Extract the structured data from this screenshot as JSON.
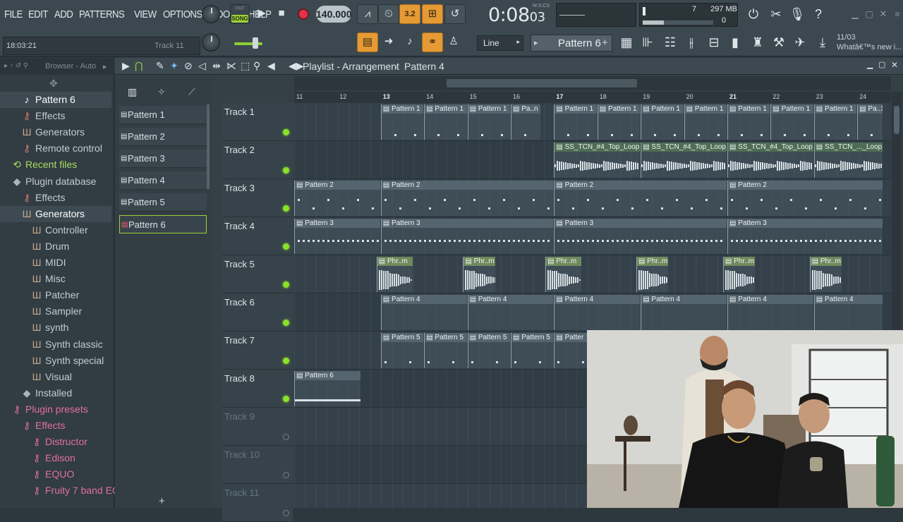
{
  "menu": [
    "FILE",
    "EDIT",
    "ADD",
    "PATTERNS",
    "VIEW",
    "OPTIONS",
    "TOOLS",
    "HELP"
  ],
  "transport": {
    "song_mode": "SONG",
    "pat_mode": "PAT",
    "tempo": "140.000",
    "time_label": "M:S:CS",
    "time_main": "0:08",
    "time_cs": "03",
    "step_value": "3.2"
  },
  "hint_bar": {
    "clock": "18:03:21",
    "track": "Track 11"
  },
  "cpu": {
    "value": "7",
    "memory": "297 MB",
    "polyphony": "0"
  },
  "toolbar2": {
    "snap_label": "Line",
    "pattern_selector": "Pattern 6",
    "news_date": "11/03",
    "news_text": "Whatâ€™s new i..."
  },
  "browser": {
    "header": "Browser - Auto",
    "items": [
      {
        "label": "Pattern 6",
        "kind": "note",
        "indent": 1,
        "selected": true
      },
      {
        "label": "Effects",
        "kind": "plug",
        "indent": 1
      },
      {
        "label": "Generators",
        "kind": "gen",
        "indent": 1
      },
      {
        "label": "Remote control",
        "kind": "plug",
        "indent": 1
      },
      {
        "label": "Recent files",
        "kind": "green",
        "indent": 0
      },
      {
        "label": "Plugin database",
        "kind": "db",
        "indent": 0
      },
      {
        "label": "Effects",
        "kind": "plug",
        "indent": 1
      },
      {
        "label": "Generators",
        "kind": "gen",
        "indent": 1,
        "selected": true
      },
      {
        "label": "Controller",
        "kind": "gen",
        "indent": 2
      },
      {
        "label": "Drum",
        "kind": "gen",
        "indent": 2
      },
      {
        "label": "MIDI",
        "kind": "gen",
        "indent": 2
      },
      {
        "label": "Misc",
        "kind": "gen",
        "indent": 2
      },
      {
        "label": "Patcher",
        "kind": "gen",
        "indent": 2
      },
      {
        "label": "Sampler",
        "kind": "gen",
        "indent": 2
      },
      {
        "label": "synth",
        "kind": "gen",
        "indent": 2
      },
      {
        "label": "Synth classic",
        "kind": "gen",
        "indent": 2
      },
      {
        "label": "Synth special",
        "kind": "gen",
        "indent": 2
      },
      {
        "label": "Visual",
        "kind": "gen",
        "indent": 2
      },
      {
        "label": "Installed",
        "kind": "db",
        "indent": 1
      },
      {
        "label": "Plugin presets",
        "kind": "pink",
        "indent": 0
      },
      {
        "label": "Effects",
        "kind": "pink",
        "indent": 1
      },
      {
        "label": "Distructor",
        "kind": "pink",
        "indent": 2
      },
      {
        "label": "Edison",
        "kind": "pink",
        "indent": 2
      },
      {
        "label": "EQUO",
        "kind": "pink",
        "indent": 2
      },
      {
        "label": "Fruity 7 band EQ",
        "kind": "pink",
        "indent": 2
      }
    ]
  },
  "playlist": {
    "title": "Playlist - Arrangement",
    "current_pattern": "Pattern 4",
    "picker": [
      "Pattern 1",
      "Pattern 2",
      "Pattern 3",
      "Pattern 4",
      "Pattern 5",
      "Pattern 6"
    ],
    "picker_selected": 5,
    "ruler_bars": [
      11,
      12,
      13,
      14,
      15,
      16,
      17,
      18,
      19,
      20,
      21,
      22,
      23,
      24
    ],
    "tracks": [
      {
        "name": "Track 1",
        "active": true
      },
      {
        "name": "Track 2",
        "active": true
      },
      {
        "name": "Track 3",
        "active": true
      },
      {
        "name": "Track 4",
        "active": true
      },
      {
        "name": "Track 5",
        "active": true
      },
      {
        "name": "Track 6",
        "active": true
      },
      {
        "name": "Track 7",
        "active": true
      },
      {
        "name": "Track 8",
        "active": true
      },
      {
        "name": "Track 9",
        "active": false
      },
      {
        "name": "Track 10",
        "active": false
      },
      {
        "name": "Track 11",
        "active": false
      }
    ],
    "clips": [
      {
        "track": 0,
        "start": 13,
        "len": 1,
        "label": "Pattern 1"
      },
      {
        "track": 0,
        "start": 14,
        "len": 1,
        "label": "Pattern 1"
      },
      {
        "track": 0,
        "start": 15,
        "len": 1,
        "label": "Pattern 1"
      },
      {
        "track": 0,
        "start": 16,
        "len": 0.7,
        "label": "Pa..n 1"
      },
      {
        "track": 0,
        "start": 17,
        "len": 1,
        "label": "Pattern 1"
      },
      {
        "track": 0,
        "start": 18,
        "len": 1,
        "label": "Pattern 1"
      },
      {
        "track": 0,
        "start": 19,
        "len": 1,
        "label": "Pattern 1"
      },
      {
        "track": 0,
        "start": 20,
        "len": 1,
        "label": "Pattern 1"
      },
      {
        "track": 0,
        "start": 21,
        "len": 1,
        "label": "Pattern 1"
      },
      {
        "track": 0,
        "start": 22,
        "len": 1,
        "label": "Pattern 1"
      },
      {
        "track": 0,
        "start": 23,
        "len": 1,
        "label": "Pattern 1"
      },
      {
        "track": 0,
        "start": 24,
        "len": 0.6,
        "label": "Pa..1"
      },
      {
        "track": 1,
        "start": 17,
        "len": 2,
        "label": "SS_TCN_#4_Top_Loop_01",
        "audio": true
      },
      {
        "track": 1,
        "start": 19,
        "len": 2,
        "label": "SS_TCN_#4_Top_Loop_01",
        "audio": true
      },
      {
        "track": 1,
        "start": 21,
        "len": 2,
        "label": "SS_TCN_#4_Top_Loop_01",
        "audio": true
      },
      {
        "track": 1,
        "start": 23,
        "len": 1.6,
        "label": "SS_TCN_..._Loop_01",
        "audio": true
      },
      {
        "track": 2,
        "start": 11,
        "len": 2,
        "label": "Pattern 2"
      },
      {
        "track": 2,
        "start": 13,
        "len": 4,
        "label": "Pattern 2"
      },
      {
        "track": 2,
        "start": 17,
        "len": 4,
        "label": "Pattern 2"
      },
      {
        "track": 2,
        "start": 21,
        "len": 3.6,
        "label": "Pattern 2"
      },
      {
        "track": 3,
        "start": 11,
        "len": 2,
        "label": "Pattern 3"
      },
      {
        "track": 3,
        "start": 13,
        "len": 4,
        "label": "Pattern 3"
      },
      {
        "track": 3,
        "start": 17,
        "len": 4,
        "label": "Pattern 3"
      },
      {
        "track": 3,
        "start": 21,
        "len": 3.6,
        "label": "Pattern 3"
      },
      {
        "track": 4,
        "start": 12.9,
        "len": 0.85,
        "label": "Phr..m",
        "audio": true,
        "green": true
      },
      {
        "track": 4,
        "start": 14.9,
        "len": 0.75,
        "label": "Phr..m",
        "audio": true,
        "green": true
      },
      {
        "track": 4,
        "start": 16.8,
        "len": 0.85,
        "label": "Phr..m",
        "audio": true,
        "green": true
      },
      {
        "track": 4,
        "start": 18.9,
        "len": 0.75,
        "label": "Phr..m",
        "audio": true,
        "green": true
      },
      {
        "track": 4,
        "start": 20.9,
        "len": 0.75,
        "label": "Phr..m",
        "audio": true,
        "green": true
      },
      {
        "track": 4,
        "start": 22.9,
        "len": 0.75,
        "label": "Phr..m",
        "audio": true,
        "green": true
      },
      {
        "track": 5,
        "start": 13,
        "len": 2,
        "label": "Pattern 4"
      },
      {
        "track": 5,
        "start": 15,
        "len": 2,
        "label": "Pattern 4"
      },
      {
        "track": 5,
        "start": 17,
        "len": 2,
        "label": "Pattern 4"
      },
      {
        "track": 5,
        "start": 19,
        "len": 2,
        "label": "Pattern 4"
      },
      {
        "track": 5,
        "start": 21,
        "len": 2,
        "label": "Pattern 4"
      },
      {
        "track": 5,
        "start": 23,
        "len": 1.6,
        "label": "Pattern 4"
      },
      {
        "track": 6,
        "start": 13,
        "len": 1,
        "label": "Pattern 5"
      },
      {
        "track": 6,
        "start": 14,
        "len": 1,
        "label": "Pattern 5"
      },
      {
        "track": 6,
        "start": 15,
        "len": 1,
        "label": "Pattern 5"
      },
      {
        "track": 6,
        "start": 16,
        "len": 1,
        "label": "Pattern 5"
      },
      {
        "track": 6,
        "start": 17,
        "len": 1,
        "label": "Patter"
      },
      {
        "track": 7,
        "start": 11,
        "len": 1.55,
        "label": "Pattern 6"
      }
    ]
  },
  "colors": {
    "accent": "#e59a35",
    "song_green": "#9bd23a",
    "led_green": "#8ae02a"
  }
}
